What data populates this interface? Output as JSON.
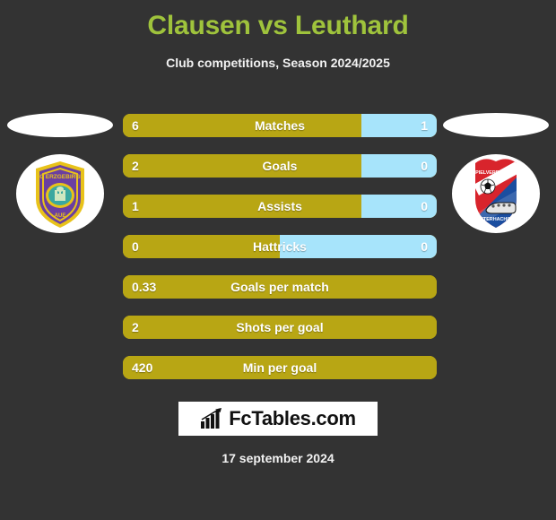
{
  "header": {
    "title": "Clausen vs Leuthard",
    "subtitle": "Club competitions, Season 2024/2025",
    "title_color": "#9fc33c"
  },
  "colors": {
    "background": "#333333",
    "home_bar": "#b8a614",
    "away_bar": "#a7e4fb",
    "text": "#ffffff"
  },
  "teams": {
    "home": {
      "badge_name": "fc-erzgebirge-aue-badge",
      "top_text": "FC ERZGEBIRGE",
      "bottom_text": "AUE"
    },
    "away": {
      "badge_name": "spvgg-unterhaching-badge",
      "top_text": "SPIELVEREINIGUNG",
      "bottom_text": "UNTERHACHING"
    }
  },
  "chart_data": {
    "type": "bar",
    "title": "Clausen vs Leuthard",
    "subtitle": "Club competitions, Season 2024/2025",
    "categories": [
      "Matches",
      "Goals",
      "Assists",
      "Hattricks",
      "Goals per match",
      "Shots per goal",
      "Min per goal"
    ],
    "series": [
      {
        "name": "Clausen",
        "values": [
          "6",
          "2",
          "1",
          "0",
          "0.33",
          "2",
          "420"
        ]
      },
      {
        "name": "Leuthard",
        "values": [
          "1",
          "0",
          "0",
          "0",
          "",
          "",
          ""
        ]
      }
    ],
    "legend": "none",
    "grid": false
  },
  "rows": [
    {
      "label": "Matches",
      "home": "6",
      "away": "1",
      "home_pct": 76,
      "has_away": true
    },
    {
      "label": "Goals",
      "home": "2",
      "away": "0",
      "home_pct": 76,
      "has_away": true
    },
    {
      "label": "Assists",
      "home": "1",
      "away": "0",
      "home_pct": 76,
      "has_away": true
    },
    {
      "label": "Hattricks",
      "home": "0",
      "away": "0",
      "home_pct": 50,
      "has_away": true
    },
    {
      "label": "Goals per match",
      "home": "0.33",
      "away": "",
      "home_pct": 100,
      "has_away": false
    },
    {
      "label": "Shots per goal",
      "home": "2",
      "away": "",
      "home_pct": 100,
      "has_away": false
    },
    {
      "label": "Min per goal",
      "home": "420",
      "away": "",
      "home_pct": 100,
      "has_away": false
    }
  ],
  "footer": {
    "logo_text": "FcTables.com",
    "date": "17 september 2024"
  }
}
